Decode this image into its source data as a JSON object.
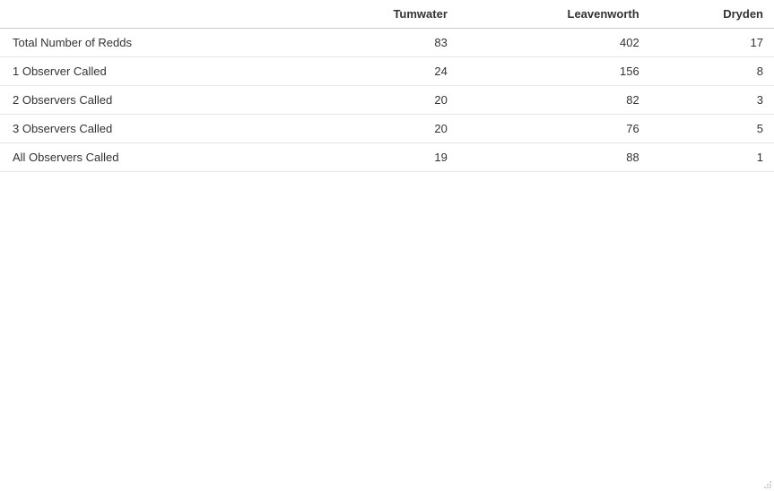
{
  "chart_data": {
    "type": "table",
    "columns": [
      "",
      "Tumwater",
      "Leavenworth",
      "Dryden"
    ],
    "rows": [
      {
        "label": "Total Number of Redds",
        "values": [
          83,
          402,
          17
        ]
      },
      {
        "label": "1 Observer Called",
        "values": [
          24,
          156,
          8
        ]
      },
      {
        "label": "2 Observers Called",
        "values": [
          20,
          82,
          3
        ]
      },
      {
        "label": "3 Observers Called",
        "values": [
          20,
          76,
          5
        ]
      },
      {
        "label": "All Observers Called",
        "values": [
          19,
          88,
          1
        ]
      }
    ]
  }
}
